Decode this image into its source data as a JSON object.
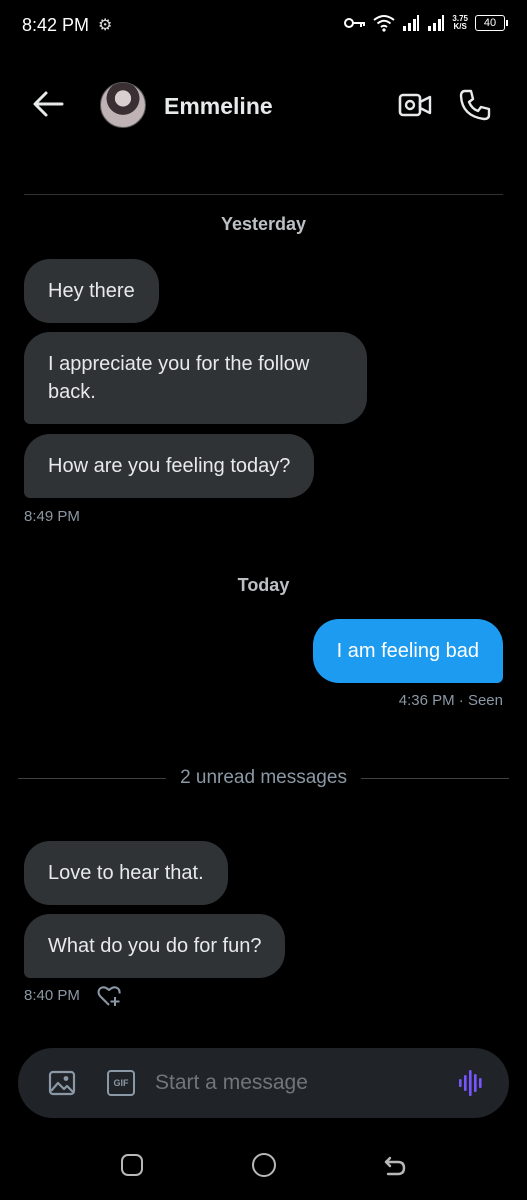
{
  "status_bar": {
    "time": "8:42 PM",
    "net_speed_value": "3.75",
    "net_speed_unit": "K/S",
    "battery": "40"
  },
  "header": {
    "contact_name": "Emmeline"
  },
  "conversation": {
    "day_1": "Yesterday",
    "received_1": [
      "Hey there",
      "I appreciate you for the follow back.",
      "How are you feeling today?"
    ],
    "received_1_time": "8:49 PM",
    "day_2": "Today",
    "sent_1": "I am feeling bad",
    "sent_1_meta": "4:36 PM · Seen",
    "unread_divider": "2 unread messages",
    "received_2": [
      "Love to hear that.",
      "What do you do for fun?"
    ],
    "received_2_time": "8:40 PM"
  },
  "composer": {
    "placeholder": "Start a message",
    "gif_label": "GIF"
  },
  "colors": {
    "background": "#000000",
    "bubble_received": "#2f3336",
    "bubble_sent": "#1d9bf0",
    "accent_voice": "#7856ff"
  }
}
